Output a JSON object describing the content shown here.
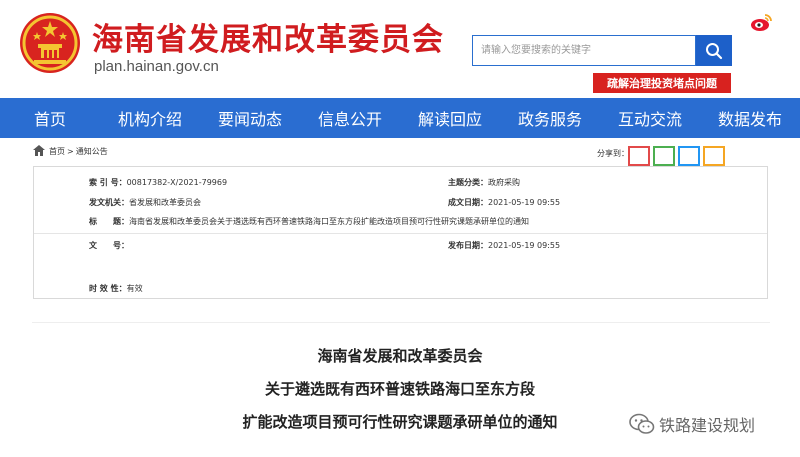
{
  "header": {
    "site_title": "海南省发展和改革委员会",
    "site_url": "plan.hainan.gov.cn",
    "search_placeholder": "请输入您要搜索的关键字",
    "promo_banner": "疏解治理投资堵点问题"
  },
  "nav": {
    "items": [
      "首页",
      "机构介绍",
      "要闻动态",
      "信息公开",
      "解读回应",
      "政务服务",
      "互动交流",
      "数据发布"
    ]
  },
  "breadcrumb": {
    "home": "首页",
    "separator": ">",
    "current": "通知公告"
  },
  "share": {
    "label": "分享到：",
    "colors": [
      "#e24a4a",
      "#4caf50",
      "#2196f3",
      "#f5a623"
    ]
  },
  "meta": {
    "index_no": {
      "label": "索 引 号：",
      "value": "00817382-X/2021-79969"
    },
    "subject": {
      "label": "主题分类：",
      "value": "政府采购"
    },
    "issuer": {
      "label": "发文机关：",
      "value": "省发展和改革委员会"
    },
    "created": {
      "label": "成文日期：",
      "value": "2021-05-19 09:55"
    },
    "title": {
      "label": "标　　题：",
      "value": "海南省发展和改革委员会关于遴选既有西环普速铁路海口至东方段扩能改造项目预可行性研究课题承研单位的通知"
    },
    "doc_no": {
      "label": "文　　号：",
      "value": ""
    },
    "published": {
      "label": "发布日期：",
      "value": "2021-05-19 09:55"
    },
    "validity": {
      "label": "时 效 性：",
      "value": "有效"
    }
  },
  "article": {
    "title_line1": "海南省发展和改革委员会",
    "title_line2": "关于遴选既有西环普速铁路海口至东方段",
    "title_line3": "扩能改造项目预可行性研究课题承研单位的通知"
  },
  "watermark": {
    "text": "铁路建设规划"
  },
  "colors": {
    "brand_red": "#d01c1f",
    "nav_blue": "#2a6dd1",
    "search_blue": "#1d60c9"
  }
}
